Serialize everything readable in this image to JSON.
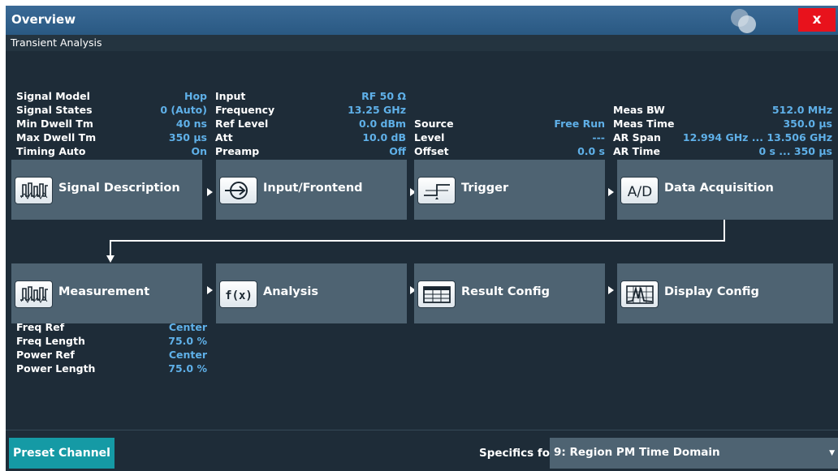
{
  "window": {
    "title": "Overview",
    "close_label": "x",
    "subtitle": "Transient Analysis"
  },
  "info": {
    "signal": [
      {
        "label": "Signal Model",
        "value": "Hop"
      },
      {
        "label": "Signal States",
        "value": "0  (Auto)"
      },
      {
        "label": "Min Dwell Tm",
        "value": "40 ns"
      },
      {
        "label": "Max Dwell Tm",
        "value": "350 µs"
      },
      {
        "label": "Timing Auto",
        "value": "On"
      }
    ],
    "input": [
      {
        "label": "Input",
        "value": "RF 50 Ω"
      },
      {
        "label": "Frequency",
        "value": "13.25 GHz"
      },
      {
        "label": "Ref Level",
        "value": "0.0 dBm"
      },
      {
        "label": "Att",
        "value": "10.0 dB"
      },
      {
        "label": "Preamp",
        "value": "Off"
      }
    ],
    "trigger": [
      {
        "label": "Source",
        "value": "Free Run"
      },
      {
        "label": "Level",
        "value": "---"
      },
      {
        "label": "Offset",
        "value": "0.0 s"
      }
    ],
    "acquisition": [
      {
        "label": "Meas BW",
        "value": "512.0 MHz"
      },
      {
        "label": "Meas Time",
        "value": "350.0 µs"
      },
      {
        "label": "AR Span",
        "value": "12.994 GHz ... 13.506 GHz"
      },
      {
        "label": "AR Time",
        "value": "0 s ... 350 µs"
      }
    ],
    "measurement": [
      {
        "label": "Freq Ref",
        "value": "Center"
      },
      {
        "label": "Freq Length",
        "value": "75.0 %"
      },
      {
        "label": "Power Ref",
        "value": "Center"
      },
      {
        "label": "Power Length",
        "value": "75.0 %"
      }
    ]
  },
  "blocks": {
    "signal_description": {
      "label": "Signal Description",
      "icon": "signal-waveform-icon"
    },
    "input_frontend": {
      "label": "Input/Frontend",
      "icon": "input-arrow-icon"
    },
    "trigger": {
      "label": "Trigger",
      "icon": "trigger-edge-icon"
    },
    "data_acquisition": {
      "label": "Data Acquisition",
      "icon": "ad-converter-icon"
    },
    "measurement": {
      "label": "Measurement",
      "icon": "signal-waveform-icon"
    },
    "analysis": {
      "label": "Analysis",
      "icon": "function-icon"
    },
    "result_config": {
      "label": "Result Config",
      "icon": "table-icon"
    },
    "display_config": {
      "label": "Display Config",
      "icon": "spectrum-display-icon"
    }
  },
  "footer": {
    "preset_label": "Preset Channel",
    "specifics_label": "Specifics for",
    "specifics_value": "9: Region PM Time Domain"
  },
  "colors": {
    "background": "#1e2c38",
    "block": "#4e6372",
    "value_text": "#5fb0e8",
    "preset_button": "#159aa5",
    "close_button": "#e8121c"
  }
}
